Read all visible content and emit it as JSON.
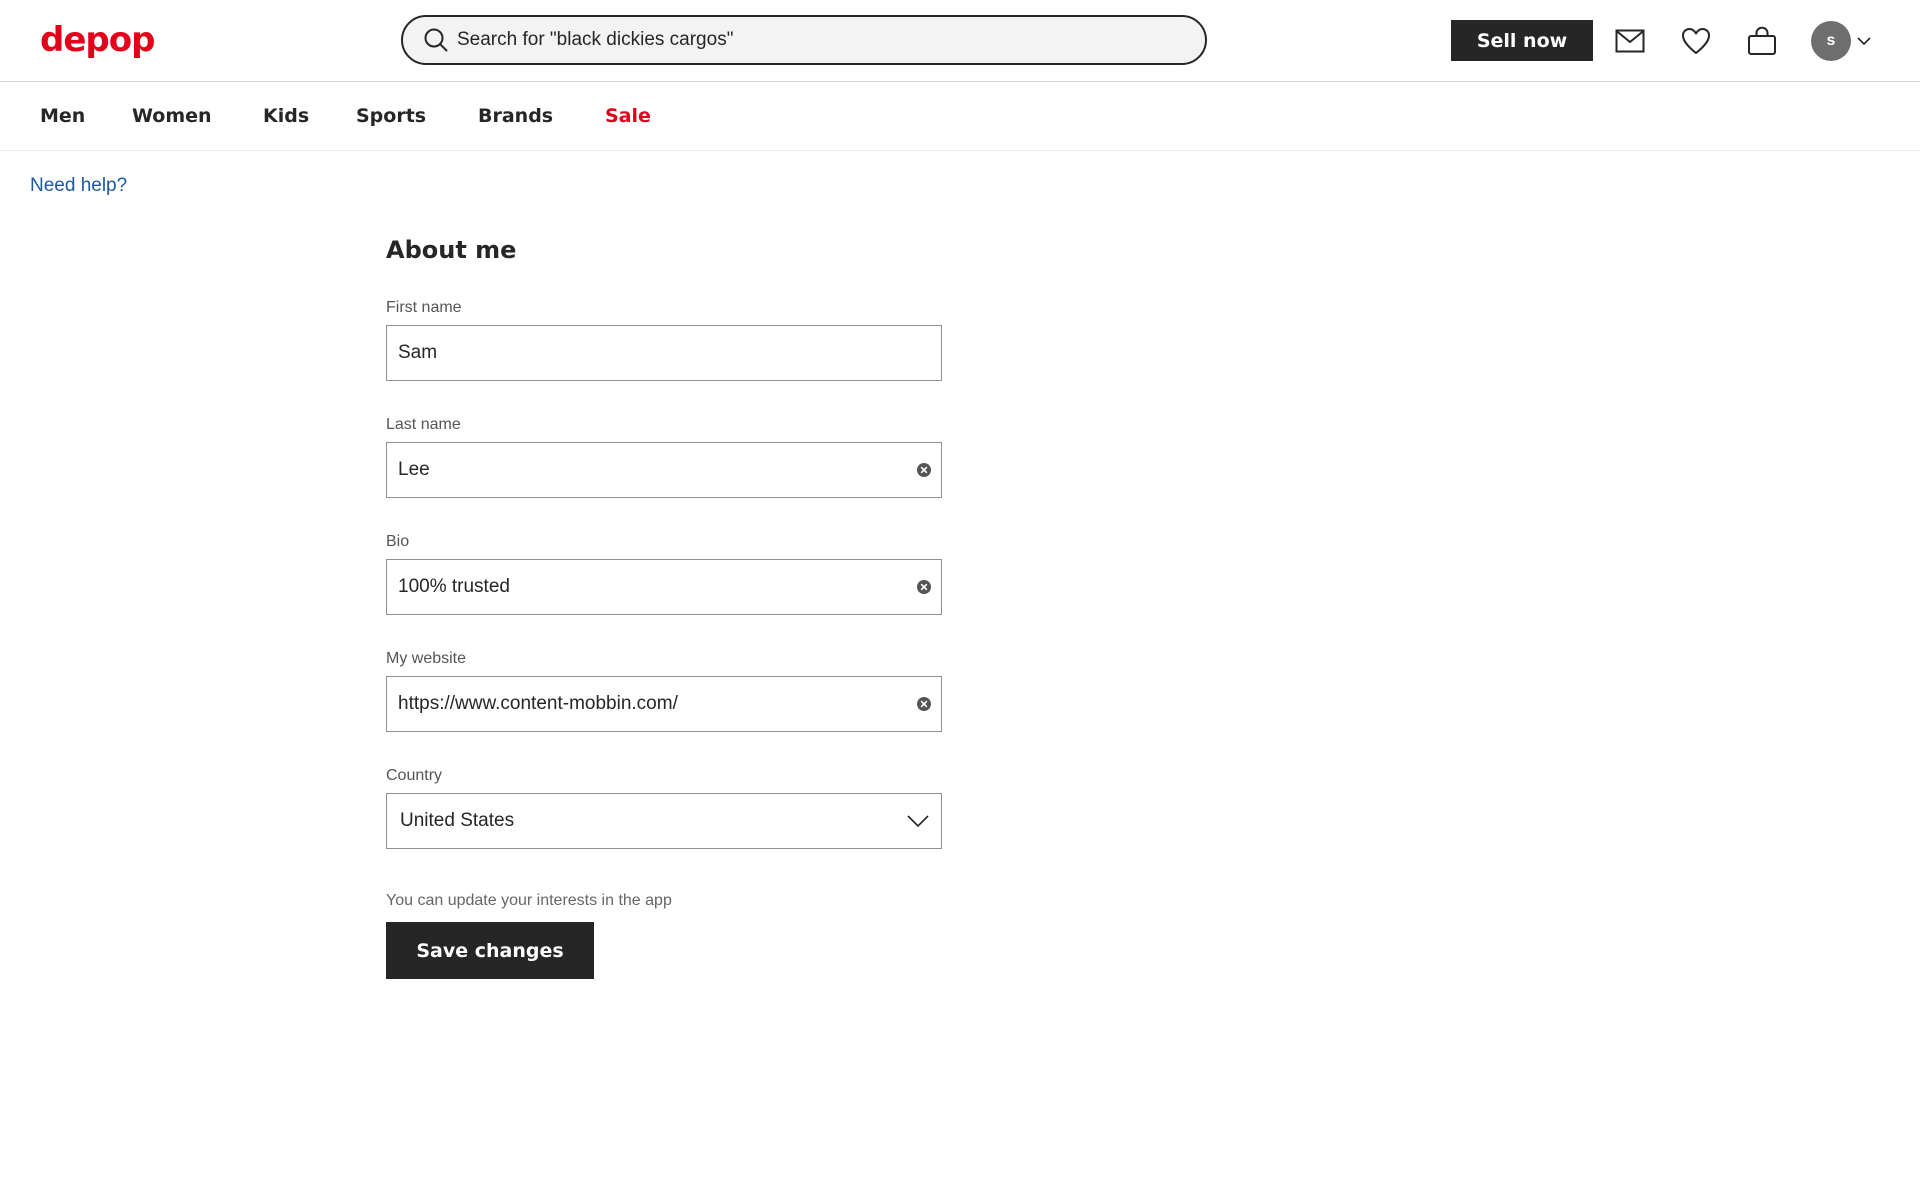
{
  "header": {
    "logo": "depop",
    "search_placeholder": "Search for \"black dickies cargos\"",
    "sell_label": "Sell now",
    "avatar_initial": "s"
  },
  "nav": {
    "items": [
      {
        "label": "Men"
      },
      {
        "label": "Women"
      },
      {
        "label": "Kids"
      },
      {
        "label": "Sports"
      },
      {
        "label": "Brands"
      },
      {
        "label": "Sale"
      }
    ]
  },
  "help_link": "Need help?",
  "form": {
    "title": "About me",
    "first_name": {
      "label": "First name",
      "value": "Sam"
    },
    "last_name": {
      "label": "Last name",
      "value": "Lee"
    },
    "bio": {
      "label": "Bio",
      "value": "100% trusted"
    },
    "website": {
      "label": "My website",
      "value": "https://www.content-mobbin.com/"
    },
    "country": {
      "label": "Country",
      "value": "United States"
    },
    "note": "You can update your interests in the app",
    "save_label": "Save changes"
  },
  "colors": {
    "brand": "#e3001b",
    "link": "#1f57a0",
    "primary_button": "#262626"
  }
}
